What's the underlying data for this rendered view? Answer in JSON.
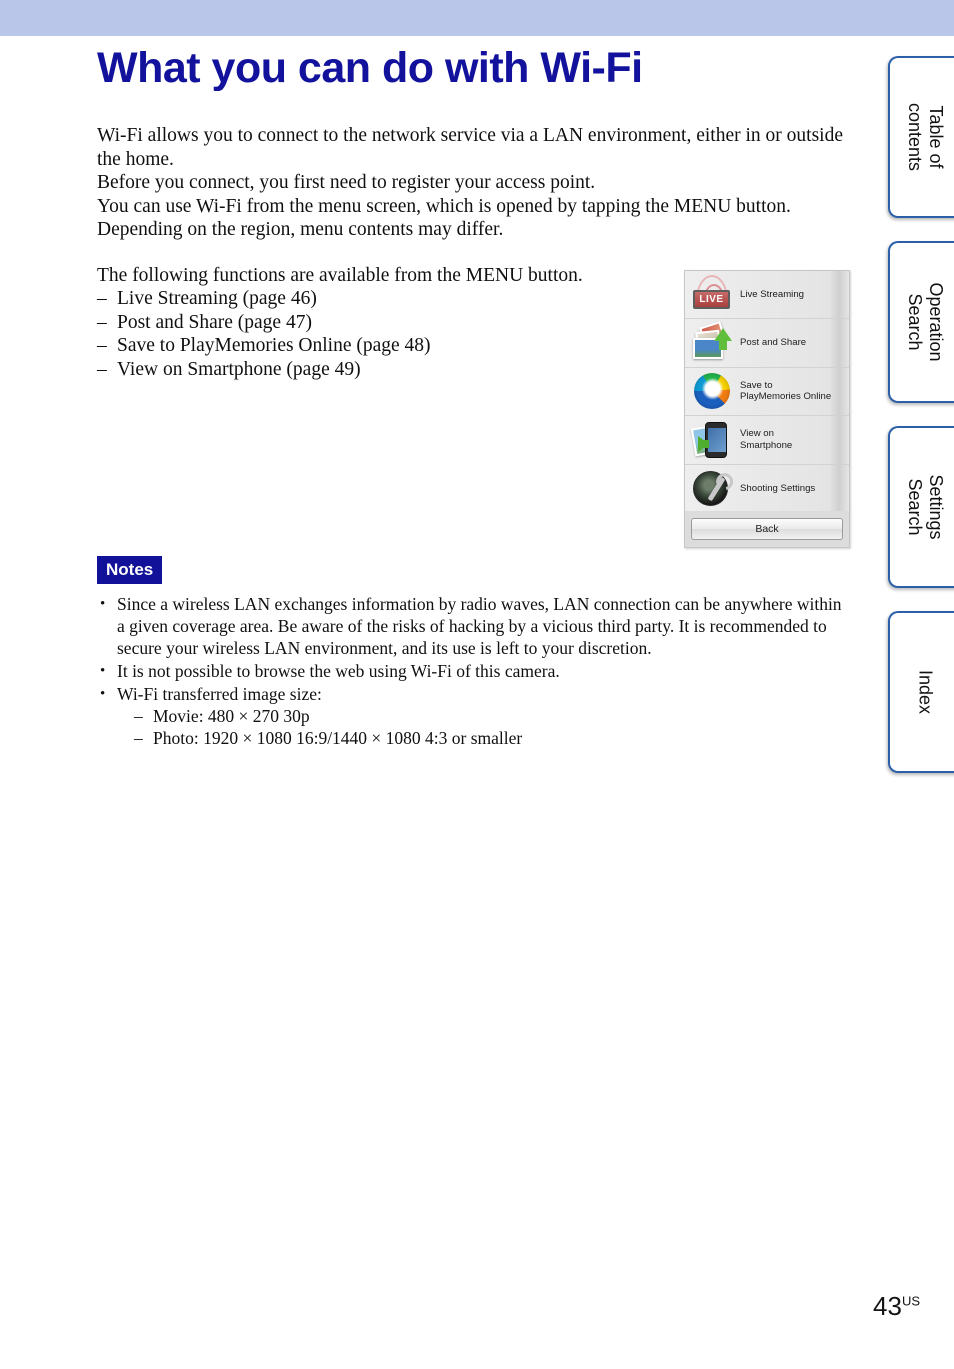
{
  "banner": {
    "color": "#b9c6ea"
  },
  "header": {
    "title": "What you can do with Wi-Fi",
    "title_color": "#12129c"
  },
  "body": {
    "intro_lines": [
      "Wi-Fi allows you to connect to the network service via a LAN environment, either in or outside the home.",
      "Before you connect, you first need to register your access point.",
      "You can use Wi-Fi from the menu screen, which is opened by tapping the MENU button.",
      "Depending on the region, menu contents may differ."
    ],
    "functions_intro": "The following functions are available from the MENU button.",
    "functions": [
      "Live Streaming (page 46)",
      "Post and Share (page 47)",
      "Save to PlayMemories Online (page 48)",
      "View on Smartphone (page 49)"
    ]
  },
  "notes": {
    "badge": "Notes",
    "badge_bg": "#11119a",
    "items": [
      "Since a wireless LAN exchanges information by radio waves, LAN connection can be anywhere within a given coverage area. Be aware of the risks of hacking by a vicious third party. It is recommended to secure your wireless LAN environment, and its use is left to your discretion.",
      "It is not possible to browse the web using Wi-Fi of this camera.",
      "Wi-Fi transferred image size:"
    ],
    "sub_items": [
      "Movie: 480 × 270 30p",
      "Photo: 1920 × 1080 16:9/1440 × 1080 4:3 or smaller"
    ]
  },
  "camera_menu": {
    "rows": [
      {
        "label": "Live Streaming",
        "icon": "live-streaming-icon"
      },
      {
        "label": "Post and Share",
        "icon": "post-and-share-icon"
      },
      {
        "label": "Save to\nPlayMemories Online",
        "icon": "playmemories-online-icon"
      },
      {
        "label": "View on\nSmartphone",
        "icon": "view-on-smartphone-icon"
      },
      {
        "label": "Shooting Settings",
        "icon": "shooting-settings-icon"
      }
    ],
    "back_label": "Back"
  },
  "side_tabs": [
    {
      "label": "Table of\ncontents"
    },
    {
      "label": "Operation\nSearch"
    },
    {
      "label": "Settings\nSearch"
    },
    {
      "label": "Index"
    }
  ],
  "footer": {
    "page_number": "43",
    "page_suffix": "US"
  }
}
